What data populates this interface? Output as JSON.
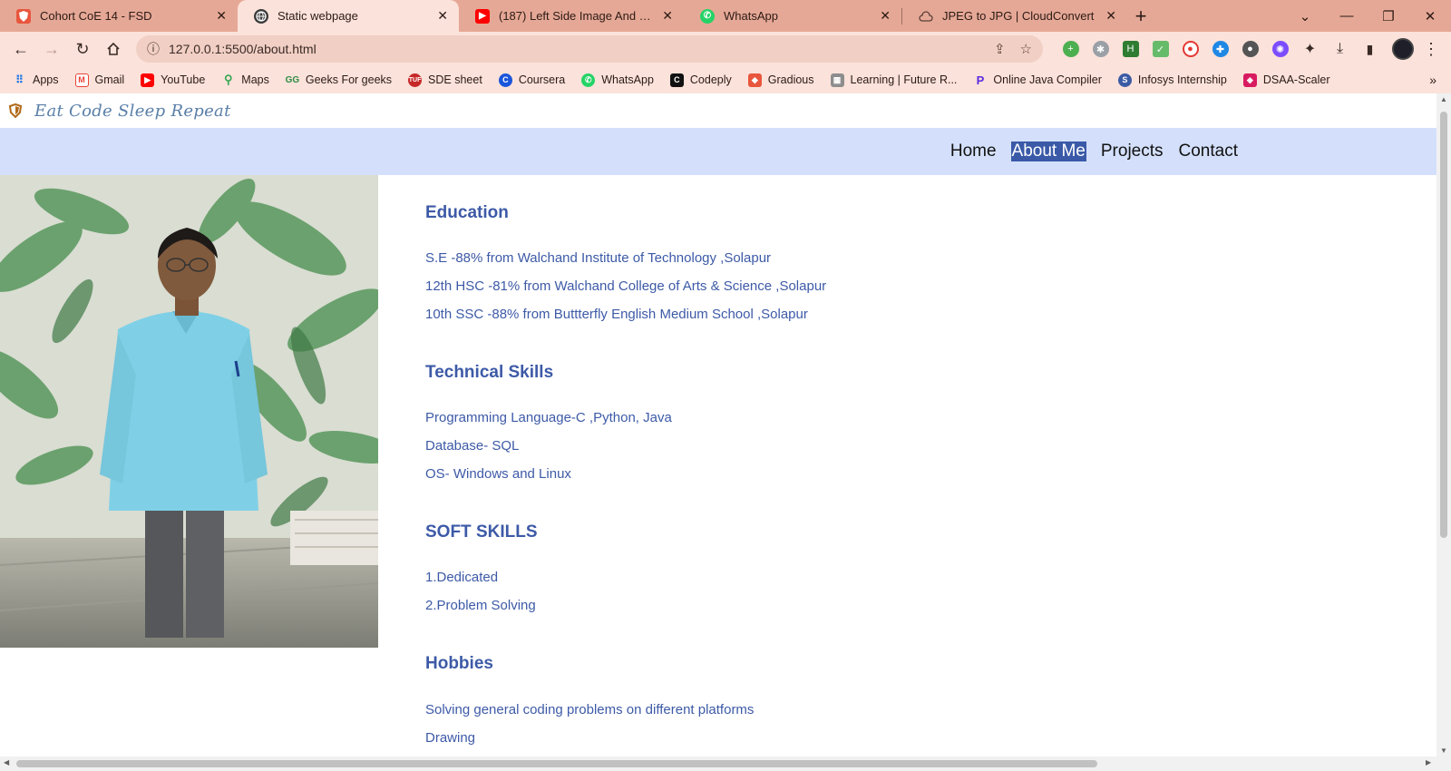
{
  "browser": {
    "tabs": [
      {
        "title": "Cohort CoE 14 - FSD",
        "favicon": "shield-icon",
        "active": false
      },
      {
        "title": "Static webpage",
        "favicon": "globe-icon",
        "active": true
      },
      {
        "title": "(187) Left Side Image And Right S",
        "favicon": "youtube-icon",
        "active": false
      },
      {
        "title": "WhatsApp",
        "favicon": "whatsapp-icon",
        "active": false
      },
      {
        "title": "JPEG to JPG | CloudConvert",
        "favicon": "cloud-icon",
        "active": false
      }
    ],
    "url": "127.0.0.1:5500/about.html",
    "bookmarks": [
      "Apps",
      "Gmail",
      "YouTube",
      "Maps",
      "Geeks For geeks",
      "SDE sheet",
      "Coursera",
      "WhatsApp",
      "Codeply",
      "Gradious",
      "Learning | Future R...",
      "Online Java Compiler",
      "Infosys Internship",
      "DSAA-Scaler"
    ],
    "bookmarks_more": "»"
  },
  "site": {
    "logo_text": "Eat Code Sleep Repeat",
    "nav": [
      "Home",
      "About Me",
      "Projects",
      "Contact"
    ],
    "active_nav": "About Me",
    "sections": [
      {
        "heading": "Education",
        "items": [
          "S.E -88% from Walchand Institute of Technology ,Solapur",
          "12th HSC -81% from Walchand College of Arts & Science ,Solapur",
          "10th SSC -88% from Buttterfly English Medium School ,Solapur"
        ]
      },
      {
        "heading": "Technical Skills",
        "items": [
          "Programming Language-C ,Python, Java",
          "Database- SQL",
          "OS- Windows and Linux"
        ]
      },
      {
        "heading": "SOFT SKILLS",
        "items": [
          "1.Dedicated",
          "2.Problem Solving"
        ]
      },
      {
        "heading": "Hobbies",
        "items": [
          "Solving general coding problems on different platforms",
          "Drawing"
        ]
      }
    ]
  },
  "colors": {
    "tabbar": "#e6a896",
    "toolbar": "#fbe2da",
    "nav_bg": "#d4e0fb",
    "nav_active_bg": "#3a5aa8",
    "content_text": "#3d5aa7"
  }
}
